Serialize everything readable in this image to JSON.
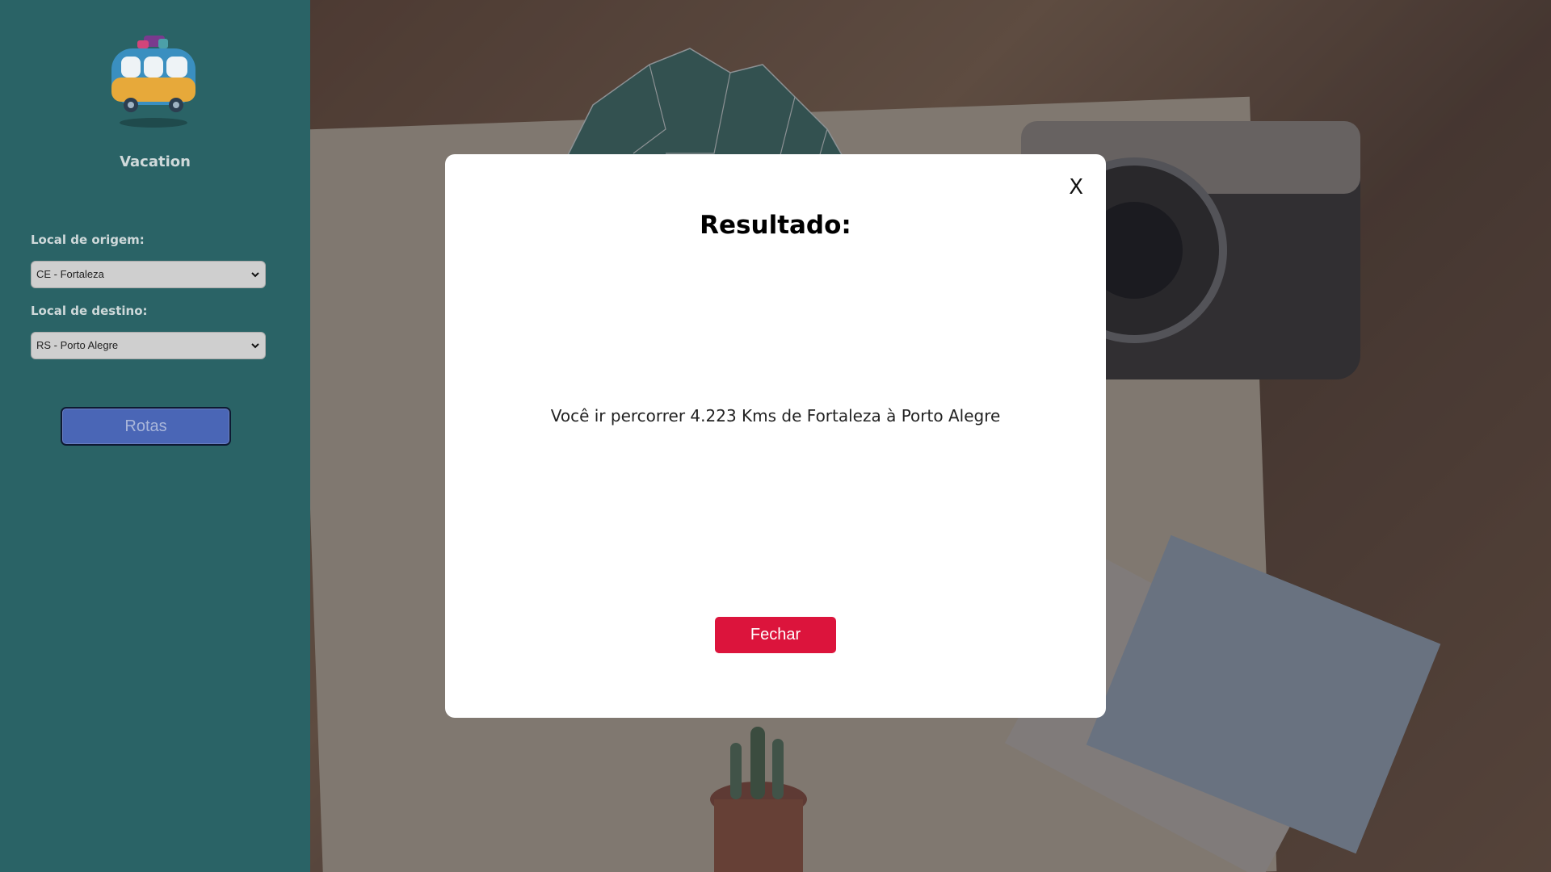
{
  "app": {
    "title": "Vacation"
  },
  "form": {
    "origin_label": "Local de origem:",
    "origin_value": "CE - Fortaleza",
    "destination_label": "Local de destino:",
    "destination_value": "RS - Porto Alegre",
    "submit_label": "Rotas"
  },
  "modal": {
    "close_label": "X",
    "title": "Resultado:",
    "message": "Você ir percorrer 4.223 Kms de Fortaleza à Porto Alegre",
    "button_label": "Fechar"
  },
  "colors": {
    "sidebar": "#2a6366",
    "submit_button": "#4a66b6",
    "close_button": "#dc143c",
    "map_fill": "#3d7468"
  },
  "icons": {
    "logo": "van-icon",
    "select_arrow": "chevron-down-icon"
  }
}
